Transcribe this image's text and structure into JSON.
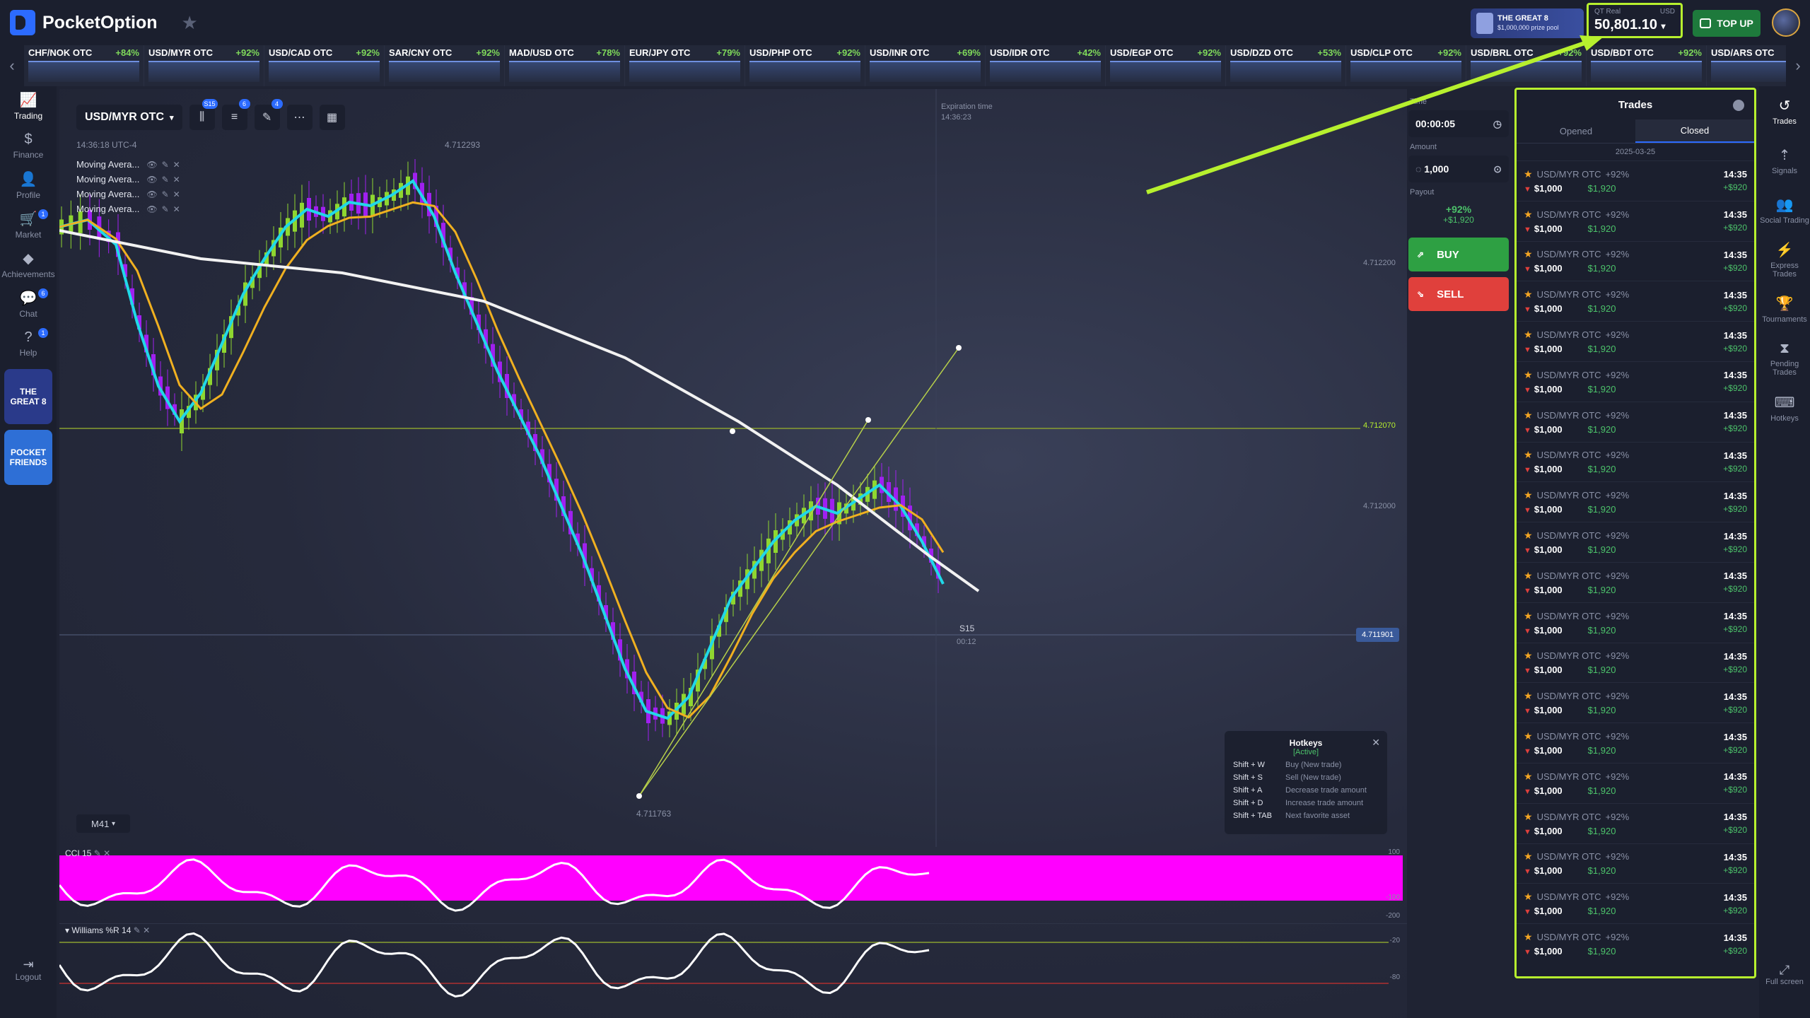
{
  "app": {
    "brand": "PocketOption"
  },
  "header": {
    "promo": {
      "title": "THE GREAT 8",
      "subtitle": "$1,000,000 prize pool"
    },
    "balance": {
      "account": "QT Real",
      "currency": "USD",
      "value": "50,801.10"
    },
    "topup_label": "TOP UP"
  },
  "ticker": [
    {
      "name": "CHF/NOK OTC",
      "pct": "+84%"
    },
    {
      "name": "USD/MYR OTC",
      "pct": "+92%"
    },
    {
      "name": "USD/CAD OTC",
      "pct": "+92%"
    },
    {
      "name": "SAR/CNY OTC",
      "pct": "+92%"
    },
    {
      "name": "MAD/USD OTC",
      "pct": "+78%"
    },
    {
      "name": "EUR/JPY OTC",
      "pct": "+79%"
    },
    {
      "name": "USD/PHP OTC",
      "pct": "+92%"
    },
    {
      "name": "USD/INR OTC",
      "pct": "+69%"
    },
    {
      "name": "USD/IDR OTC",
      "pct": "+42%"
    },
    {
      "name": "USD/EGP OTC",
      "pct": "+92%"
    },
    {
      "name": "USD/DZD OTC",
      "pct": "+53%"
    },
    {
      "name": "USD/CLP OTC",
      "pct": "+92%"
    },
    {
      "name": "USD/BRL OTC",
      "pct": "+92%"
    },
    {
      "name": "USD/BDT OTC",
      "pct": "+92%"
    },
    {
      "name": "USD/ARS OTC",
      "pct": ""
    }
  ],
  "leftnav": [
    {
      "label": "Trading",
      "icon": "chart-line-icon"
    },
    {
      "label": "Finance",
      "icon": "dollar-icon"
    },
    {
      "label": "Profile",
      "icon": "user-icon"
    },
    {
      "label": "Market",
      "icon": "cart-icon"
    },
    {
      "label": "Achievements",
      "icon": "diamond-icon"
    },
    {
      "label": "Chat",
      "icon": "chat-icon"
    },
    {
      "label": "Help",
      "icon": "help-icon"
    }
  ],
  "nav_badges": {
    "market": "1",
    "chat": "6",
    "help": "1"
  },
  "promo_tiles": {
    "great8": "THE GREAT 8",
    "friends": "POCKET FRIENDS"
  },
  "logout_label": "Logout",
  "chart": {
    "asset": "USD/MYR OTC",
    "toolbar_badges": {
      "timeframe": "S15",
      "indicators": "6",
      "drawings": "4"
    },
    "time": "14:36:18 UTC-4",
    "indicators": [
      "Moving Avera...",
      "Moving Avera...",
      "Moving Avera...",
      "Moving Avera..."
    ],
    "top_price": "4.712293",
    "expiration_label": "Expiration time",
    "expiration_time": "14:36:23",
    "price_levels": [
      "4.712200",
      "4.712070",
      "4.712000",
      "4.711901"
    ],
    "bottom_price": "4.711763",
    "timeframe": "M41",
    "s_label": "S15",
    "t_label": "00:12",
    "cci_label": "CCI 15",
    "cci_axis": [
      "100",
      "-100",
      "-200"
    ],
    "wpr_label": "Williams %R 14",
    "wpr_axis": [
      "-20",
      "-80"
    ],
    "hotkeys": {
      "title": "Hotkeys",
      "status": "[Active]",
      "rows": [
        {
          "key": "Shift + W",
          "desc": "Buy (New trade)"
        },
        {
          "key": "Shift + S",
          "desc": "Sell (New trade)"
        },
        {
          "key": "Shift + A",
          "desc": "Decrease trade amount"
        },
        {
          "key": "Shift + D",
          "desc": "Increase trade amount"
        },
        {
          "key": "Shift + TAB",
          "desc": "Next favorite asset"
        }
      ]
    }
  },
  "trade_panel": {
    "time_label": "Time",
    "time": "00:00:05",
    "amount_label": "Amount",
    "amount": "1,000",
    "payout_label": "Payout",
    "payout_pct": "+92%",
    "payout_amount": "+$1,920",
    "buy": "BUY",
    "sell": "SELL"
  },
  "trades": {
    "title": "Trades",
    "tabs": [
      "Opened",
      "Closed"
    ],
    "date": "2025-03-25",
    "rows": [
      {
        "asset": "USD/MYR OTC",
        "pct": "+92%",
        "amount": "$1,000",
        "payout": "$1,920",
        "time": "14:35",
        "profit": "+$920"
      },
      {
        "asset": "USD/MYR OTC",
        "pct": "+92%",
        "amount": "$1,000",
        "payout": "$1,920",
        "time": "14:35",
        "profit": "+$920"
      },
      {
        "asset": "USD/MYR OTC",
        "pct": "+92%",
        "amount": "$1,000",
        "payout": "$1,920",
        "time": "14:35",
        "profit": "+$920"
      },
      {
        "asset": "USD/MYR OTC",
        "pct": "+92%",
        "amount": "$1,000",
        "payout": "$1,920",
        "time": "14:35",
        "profit": "+$920"
      },
      {
        "asset": "USD/MYR OTC",
        "pct": "+92%",
        "amount": "$1,000",
        "payout": "$1,920",
        "time": "14:35",
        "profit": "+$920"
      },
      {
        "asset": "USD/MYR OTC",
        "pct": "+92%",
        "amount": "$1,000",
        "payout": "$1,920",
        "time": "14:35",
        "profit": "+$920"
      },
      {
        "asset": "USD/MYR OTC",
        "pct": "+92%",
        "amount": "$1,000",
        "payout": "$1,920",
        "time": "14:35",
        "profit": "+$920"
      },
      {
        "asset": "USD/MYR OTC",
        "pct": "+92%",
        "amount": "$1,000",
        "payout": "$1,920",
        "time": "14:35",
        "profit": "+$920"
      },
      {
        "asset": "USD/MYR OTC",
        "pct": "+92%",
        "amount": "$1,000",
        "payout": "$1,920",
        "time": "14:35",
        "profit": "+$920"
      },
      {
        "asset": "USD/MYR OTC",
        "pct": "+92%",
        "amount": "$1,000",
        "payout": "$1,920",
        "time": "14:35",
        "profit": "+$920"
      },
      {
        "asset": "USD/MYR OTC",
        "pct": "+92%",
        "amount": "$1,000",
        "payout": "$1,920",
        "time": "14:35",
        "profit": "+$920"
      },
      {
        "asset": "USD/MYR OTC",
        "pct": "+92%",
        "amount": "$1,000",
        "payout": "$1,920",
        "time": "14:35",
        "profit": "+$920"
      },
      {
        "asset": "USD/MYR OTC",
        "pct": "+92%",
        "amount": "$1,000",
        "payout": "$1,920",
        "time": "14:35",
        "profit": "+$920"
      },
      {
        "asset": "USD/MYR OTC",
        "pct": "+92%",
        "amount": "$1,000",
        "payout": "$1,920",
        "time": "14:35",
        "profit": "+$920"
      },
      {
        "asset": "USD/MYR OTC",
        "pct": "+92%",
        "amount": "$1,000",
        "payout": "$1,920",
        "time": "14:35",
        "profit": "+$920"
      },
      {
        "asset": "USD/MYR OTC",
        "pct": "+92%",
        "amount": "$1,000",
        "payout": "$1,920",
        "time": "14:35",
        "profit": "+$920"
      },
      {
        "asset": "USD/MYR OTC",
        "pct": "+92%",
        "amount": "$1,000",
        "payout": "$1,920",
        "time": "14:35",
        "profit": "+$920"
      },
      {
        "asset": "USD/MYR OTC",
        "pct": "+92%",
        "amount": "$1,000",
        "payout": "$1,920",
        "time": "14:35",
        "profit": "+$920"
      },
      {
        "asset": "USD/MYR OTC",
        "pct": "+92%",
        "amount": "$1,000",
        "payout": "$1,920",
        "time": "14:35",
        "profit": "+$920"
      },
      {
        "asset": "USD/MYR OTC",
        "pct": "+92%",
        "amount": "$1,000",
        "payout": "$1,920",
        "time": "14:35",
        "profit": "+$920"
      }
    ]
  },
  "rightnav": [
    {
      "label": "Trades",
      "icon": "history-icon"
    },
    {
      "label": "Signals",
      "icon": "signal-icon"
    },
    {
      "label": "Social Trading",
      "icon": "people-icon"
    },
    {
      "label": "Express Trades",
      "icon": "express-icon"
    },
    {
      "label": "Tournaments",
      "icon": "trophy-icon"
    },
    {
      "label": "Pending Trades",
      "icon": "hourglass-icon"
    },
    {
      "label": "Hotkeys",
      "icon": "keyboard-icon"
    }
  ],
  "fullscreen_label": "Full screen",
  "colors": {
    "accent_highlight": "#b7f02e",
    "buy": "#2ea043",
    "sell": "#e0403c",
    "cci": "#ff00ff"
  }
}
